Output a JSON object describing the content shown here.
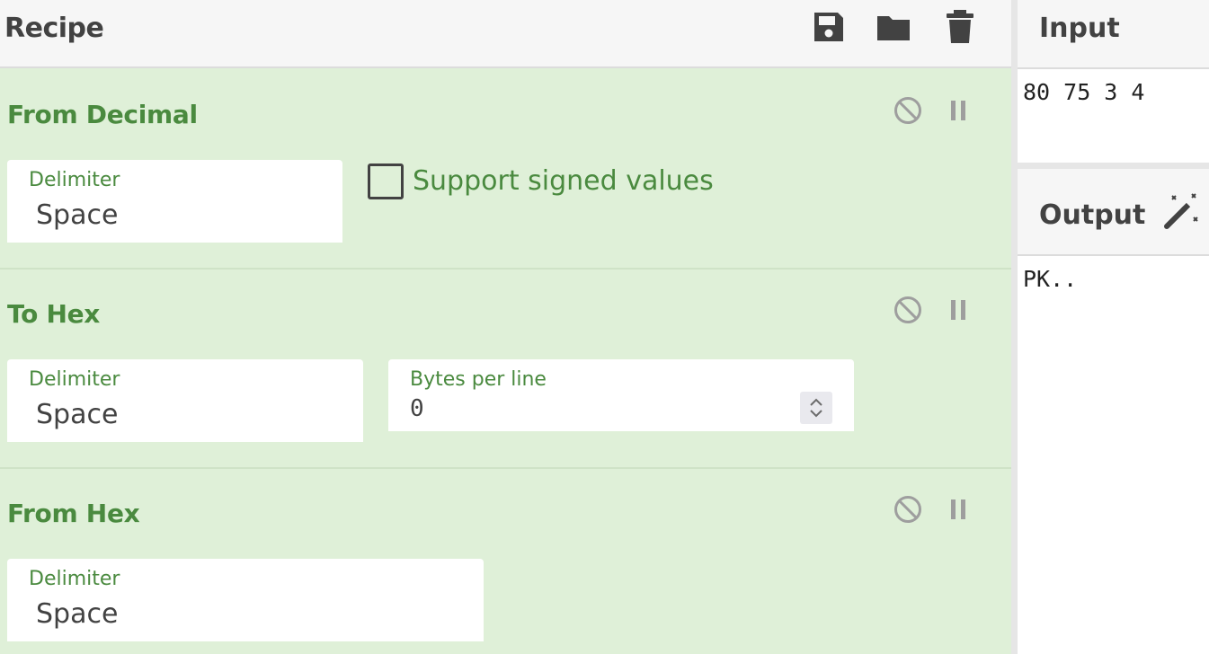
{
  "recipe": {
    "title": "Recipe",
    "icons": [
      "save-icon",
      "folder-icon",
      "trash-icon"
    ],
    "operations": [
      {
        "title": "From Decimal",
        "fields": [
          {
            "label": "Delimiter",
            "value": "Space"
          }
        ],
        "checkbox": {
          "label": "Support signed values",
          "checked": false
        }
      },
      {
        "title": "To Hex",
        "fields": [
          {
            "label": "Delimiter",
            "value": "Space"
          },
          {
            "label": "Bytes per line",
            "value": "0"
          }
        ]
      },
      {
        "title": "From Hex",
        "fields": [
          {
            "label": "Delimiter",
            "value": "Space"
          }
        ]
      }
    ]
  },
  "input": {
    "title": "Input",
    "text": "80 75 3 4"
  },
  "output": {
    "title": "Output",
    "text": "PK.."
  },
  "colors": {
    "accent_green": "#4a8a3f",
    "operation_bg": "#dff0d8",
    "header_bg": "#f6f6f6",
    "icon_dark": "#424242",
    "icon_gray": "#9e9e9e"
  }
}
